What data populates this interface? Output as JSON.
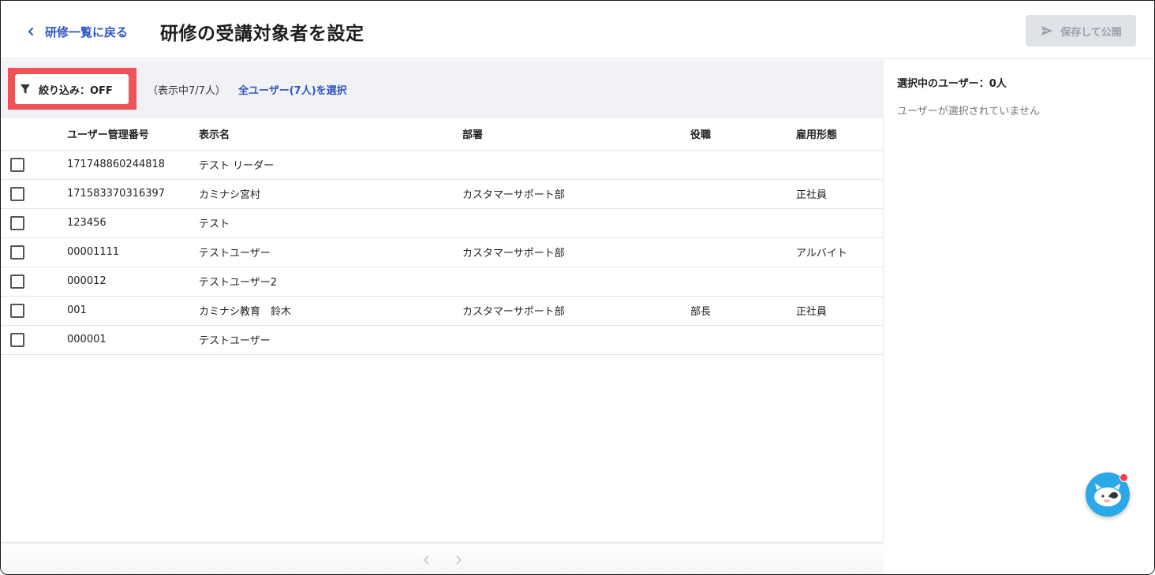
{
  "header": {
    "back_label": "研修一覧に戻る",
    "title": "研修の受講対象者を設定",
    "publish_label": "保存して公開"
  },
  "toolbar": {
    "filter_label": "絞り込み：OFF",
    "count_text": "（表示中7/7人）",
    "select_all_label": "全ユーザー(7人)を選択",
    "highlight_color": "#f0525a"
  },
  "table": {
    "columns": [
      "ユーザー管理番号",
      "表示名",
      "部署",
      "役職",
      "雇用形態"
    ],
    "rows": [
      {
        "id": "171748860244818",
        "name": "テスト リーダー",
        "dept": "",
        "position": "",
        "employment": ""
      },
      {
        "id": "171583370316397",
        "name": "カミナシ宮村",
        "dept": "カスタマーサポート部",
        "position": "",
        "employment": "正社員"
      },
      {
        "id": "123456",
        "name": "テスト",
        "dept": "",
        "position": "",
        "employment": ""
      },
      {
        "id": "00001111",
        "name": "テストユーザー",
        "dept": "カスタマーサポート部",
        "position": "",
        "employment": "アルバイト"
      },
      {
        "id": "000012",
        "name": "テストユーザー2",
        "dept": "",
        "position": "",
        "employment": ""
      },
      {
        "id": "001",
        "name": "カミナシ教育　鈴木",
        "dept": "カスタマーサポート部",
        "position": "部長",
        "employment": "正社員"
      },
      {
        "id": "000001",
        "name": "テストユーザー",
        "dept": "",
        "position": "",
        "employment": ""
      }
    ]
  },
  "side": {
    "title": "選択中のユーザー：0人",
    "empty_text": "ユーザーが選択されていません"
  },
  "colors": {
    "link": "#2f55c5",
    "publish_bg": "#dfe2e7",
    "chat_bg": "#2aa8e8",
    "notify_dot": "#f03d48"
  },
  "icons": [
    "chevron-left-icon",
    "send-icon",
    "filter-icon",
    "chat-mascot-icon"
  ]
}
